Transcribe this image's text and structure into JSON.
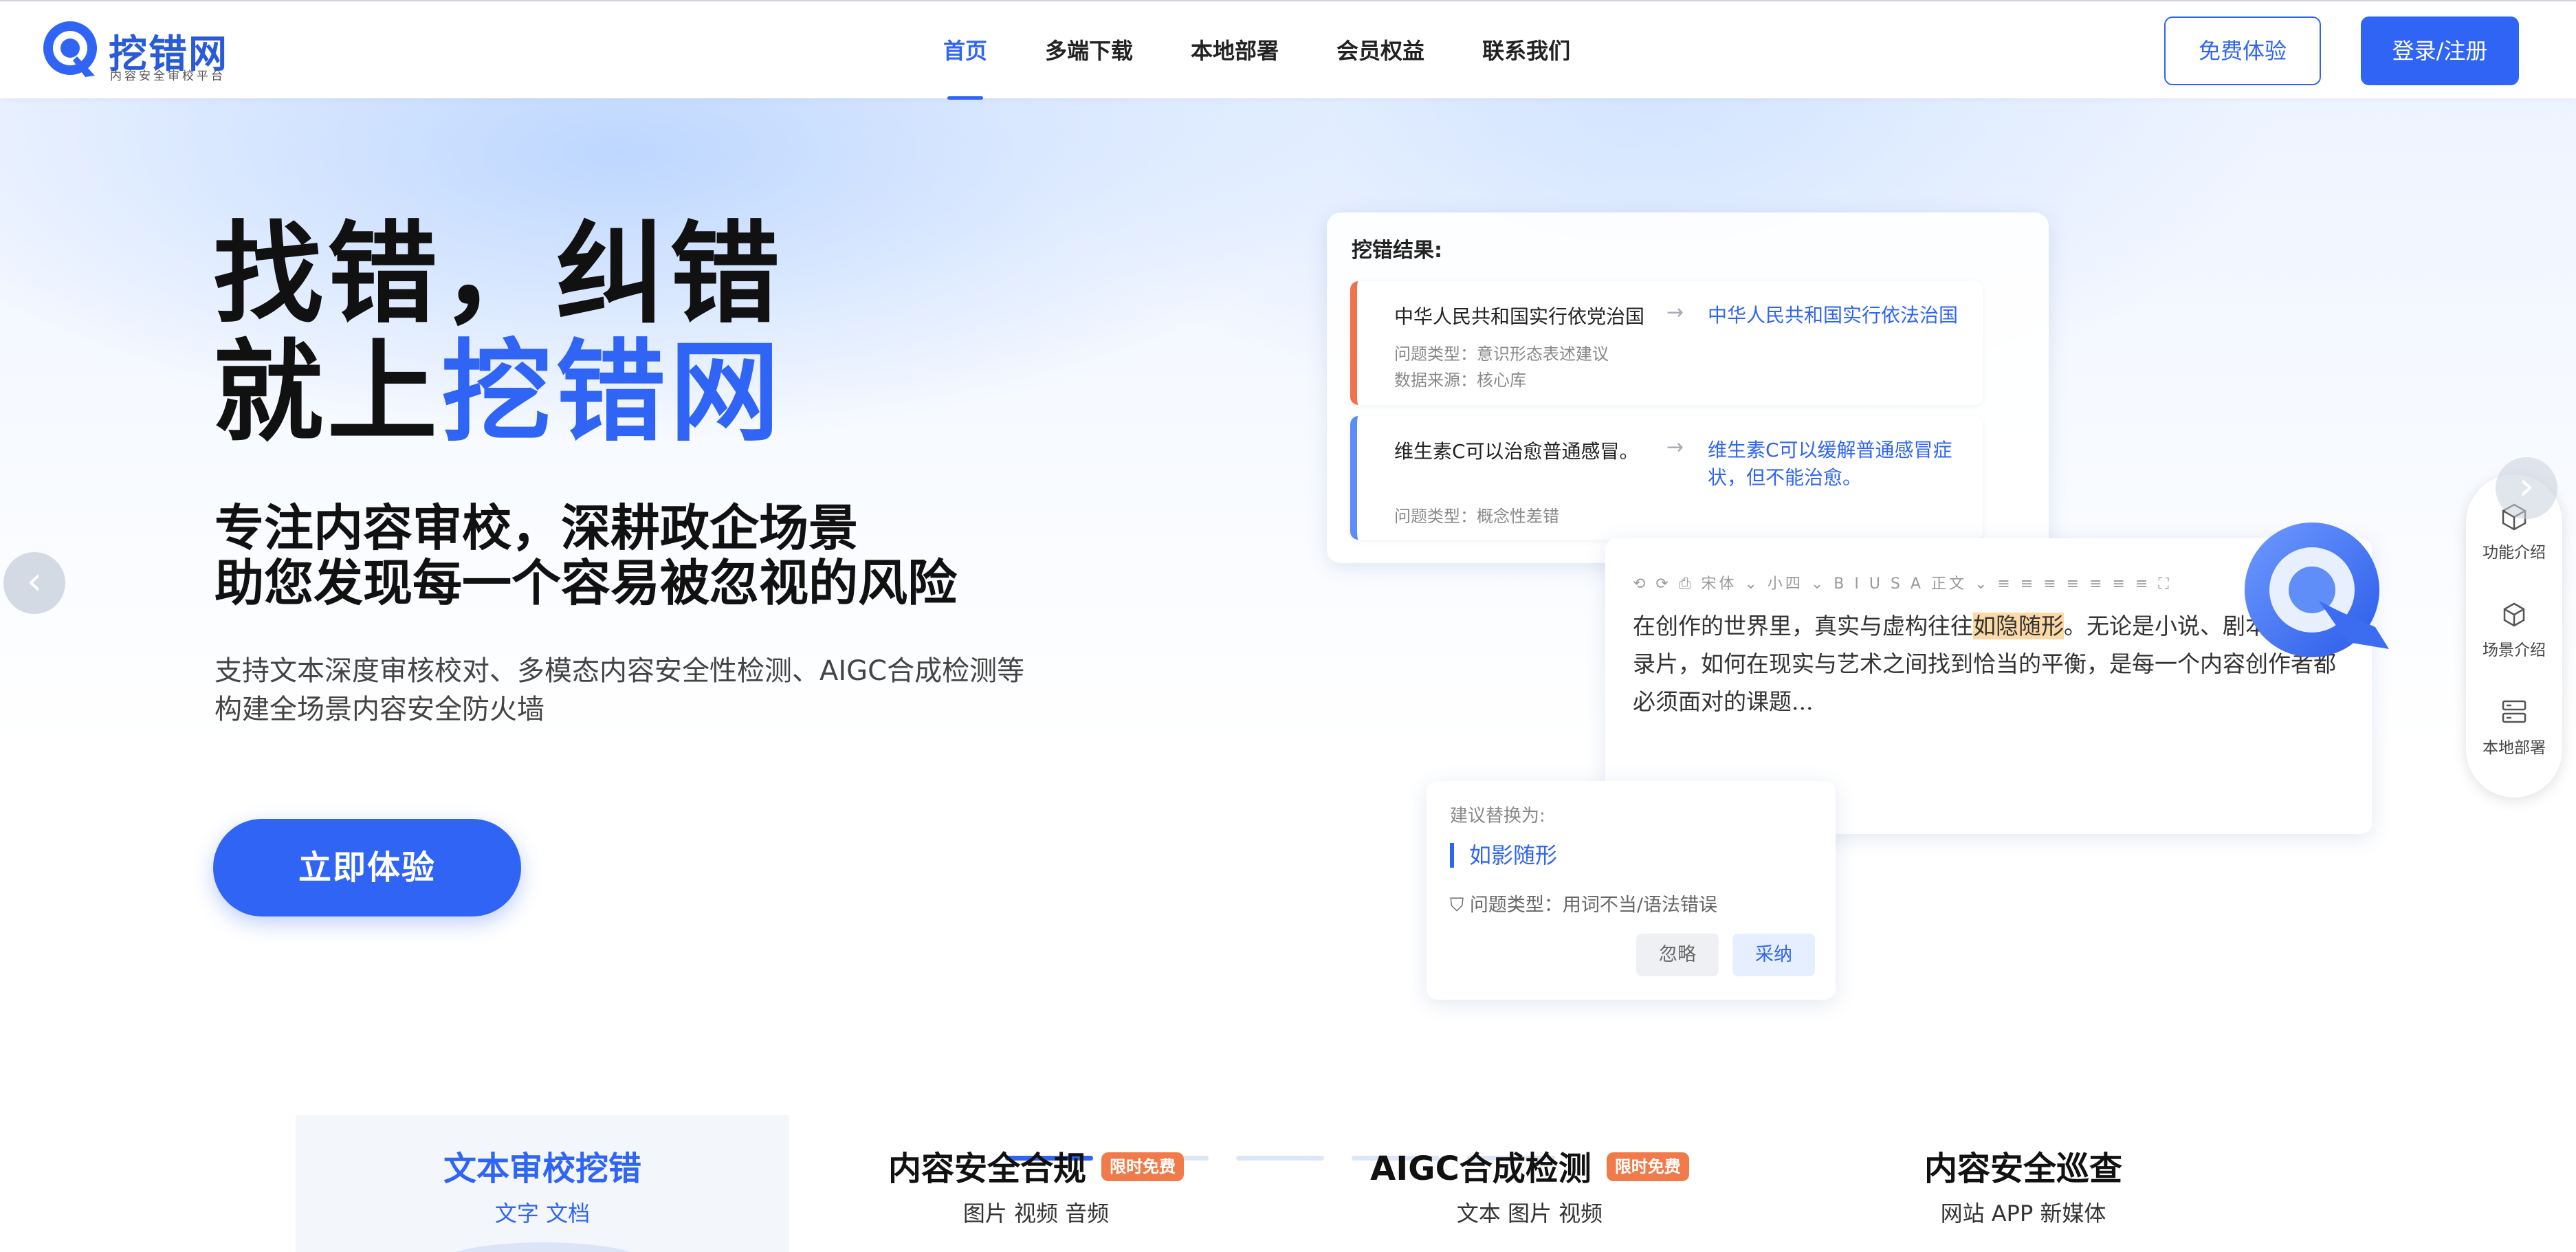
{
  "header": {
    "logo_name": "挖错网",
    "logo_tagline": "内容安全审校平台",
    "nav": [
      {
        "label": "首页",
        "active": true
      },
      {
        "label": "多端下载",
        "active": false
      },
      {
        "label": "本地部署",
        "active": false
      },
      {
        "label": "会员权益",
        "active": false
      },
      {
        "label": "联系我们",
        "active": false
      }
    ],
    "trial_button": "免费体验",
    "login_button": "登录/注册"
  },
  "hero": {
    "title_line1": "找错，纠错",
    "title_line2_prefix": "就上",
    "title_line2_accent": "挖错网",
    "subtitle_line1": "专注内容审校，深耕政企场景",
    "subtitle_line2": "助您发现每一个容易被忽视的风险",
    "desc_line1": "支持文本深度审核校对、多模态内容安全性检测、AIGC合成检测等",
    "desc_line2": "构建全场景内容安全防火墙",
    "cta": "立即体验"
  },
  "result_card": {
    "title": "挖错结果:",
    "items": [
      {
        "original": "中华人民共和国实行依党治国",
        "suggestion": "中华人民共和国实行依法治国",
        "meta": [
          "问题类型：意识形态表述建议",
          "数据来源：核心库"
        ]
      },
      {
        "original": "维生素C可以治愈普通感冒。",
        "suggestion": "维生素C可以缓解普通感冒症状，但不能治愈。",
        "meta": [
          "问题类型：概念性差错"
        ]
      }
    ]
  },
  "editor": {
    "toolbar": "⟲ ⟳ ⎙  宋体 ⌄  小四 ⌄   B  I  U  S  A   正文 ⌄  ≡ ≡ ≡ ≡ ≡ ≡ ≡  ⛶",
    "text_before": "在创作的世界里，真实与虚构往往",
    "text_highlight": "如隐随形",
    "text_after": "。无论是小说、剧本还是纪录片，如何在现实与艺术之间找到恰当的平衡，是每一个内容创作者都必须面对的课题..."
  },
  "suggest": {
    "label": "建议替换为:",
    "word": "如影随形",
    "type": "问题类型：用词不当/语法错误",
    "ignore": "忽略",
    "accept": "采纳"
  },
  "side_menu": [
    {
      "label": "功能介绍",
      "icon": "cube-icon"
    },
    {
      "label": "场景介绍",
      "icon": "box-icon"
    },
    {
      "label": "本地部署",
      "icon": "server-icon"
    }
  ],
  "carousel": {
    "slides": 5,
    "active": 0
  },
  "features": [
    {
      "title": "文本审校挖错",
      "badge": "",
      "sub": "文字 文档",
      "active": true
    },
    {
      "title": "内容安全合规",
      "badge": "限时免费",
      "sub": "图片 视频 音频",
      "active": false
    },
    {
      "title": "AIGC合成检测",
      "badge": "限时免费",
      "sub": "文本 图片 视频",
      "active": false
    },
    {
      "title": "内容安全巡查",
      "badge": "",
      "sub": "网站 APP 新媒体",
      "active": false
    }
  ],
  "colors": {
    "brand": "#2f64f5",
    "badge": "#f07a4a",
    "error_bar": "#f0714a",
    "highlight": "#fbd9a6"
  }
}
